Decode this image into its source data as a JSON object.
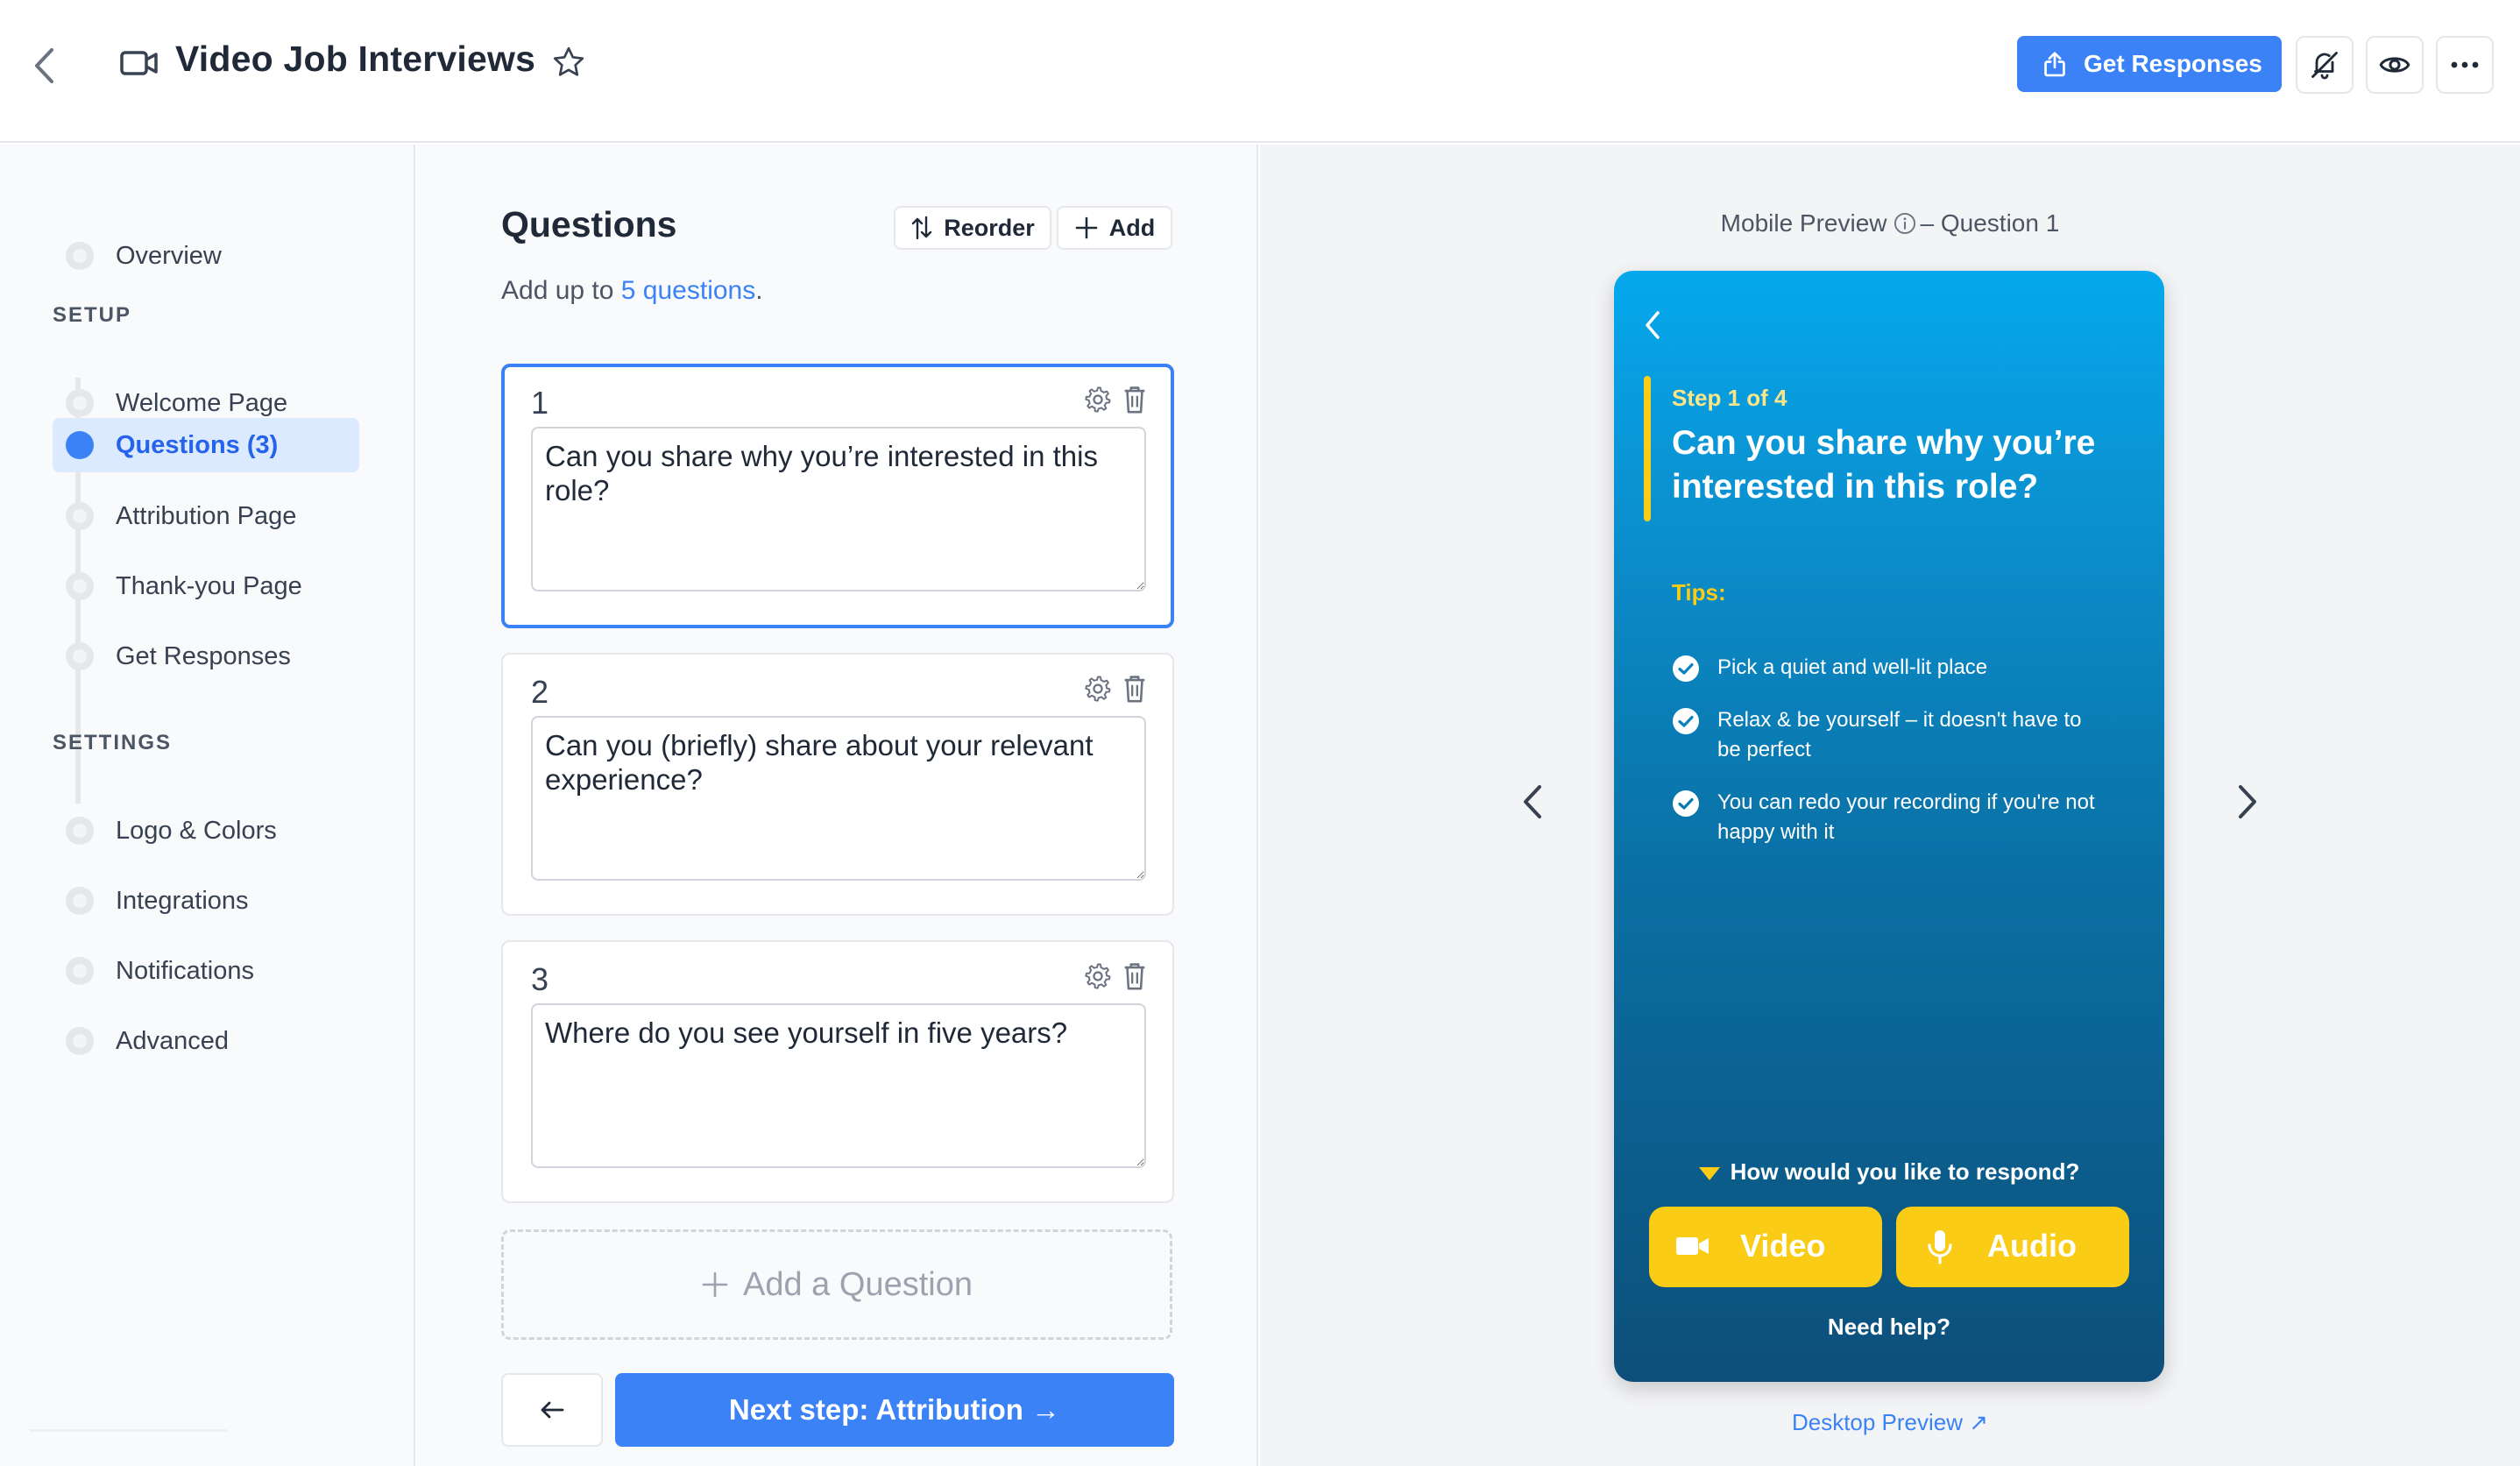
{
  "header": {
    "title": "Video Job Interviews",
    "get_responses_label": "Get Responses",
    "icons": [
      "back-chevron-icon",
      "video-camera-icon",
      "star-icon",
      "share-icon",
      "bell-off-icon",
      "eye-icon",
      "more-horizontal-icon"
    ]
  },
  "sidebar": {
    "overview": "Overview",
    "setup_heading": "SETUP",
    "setup_items": [
      {
        "label": "Welcome Page",
        "active": false
      },
      {
        "label": "Questions (3)",
        "active": true
      },
      {
        "label": "Attribution Page",
        "active": false
      },
      {
        "label": "Thank-you Page",
        "active": false
      },
      {
        "label": "Get Responses",
        "active": false
      }
    ],
    "settings_heading": "SETTINGS",
    "settings_items": [
      {
        "label": "Logo & Colors"
      },
      {
        "label": "Integrations"
      },
      {
        "label": "Notifications"
      },
      {
        "label": "Advanced"
      }
    ]
  },
  "questions": {
    "heading": "Questions",
    "reorder_label": "Reorder",
    "add_label": "Add",
    "subtitle_prefix": "Add up to ",
    "subtitle_link": "5 questions",
    "subtitle_suffix": ".",
    "items": [
      {
        "number": "1",
        "text": "Can you share why you’re interested in this role?"
      },
      {
        "number": "2",
        "text": "Can you (briefly) share about your relevant experience?"
      },
      {
        "number": "3",
        "text": "Where do you see yourself in five years?"
      }
    ],
    "add_question_label": "Add a Question",
    "next_step_label": "Next step: Attribution →"
  },
  "preview": {
    "label_prefix": "Mobile Preview",
    "label_suffix": "– Question 1",
    "step": "Step 1 of 4",
    "question": "Can you share why you’re interested in this role?",
    "tips_label": "Tips:",
    "tips": [
      "Pick a quiet and well-lit place",
      "Relax & be yourself – it doesn't have to be perfect",
      "You can redo your recording if you're not happy with it"
    ],
    "respond_prompt": "How would you like to respond?",
    "video_label": "Video",
    "audio_label": "Audio",
    "need_help": "Need help?",
    "desktop_link": "Desktop Preview ↗"
  },
  "colors": {
    "accent": "#3b82f6",
    "accent_yellow": "#facc15",
    "phone_top": "#05a8ed",
    "phone_bottom": "#0d4f7a"
  }
}
